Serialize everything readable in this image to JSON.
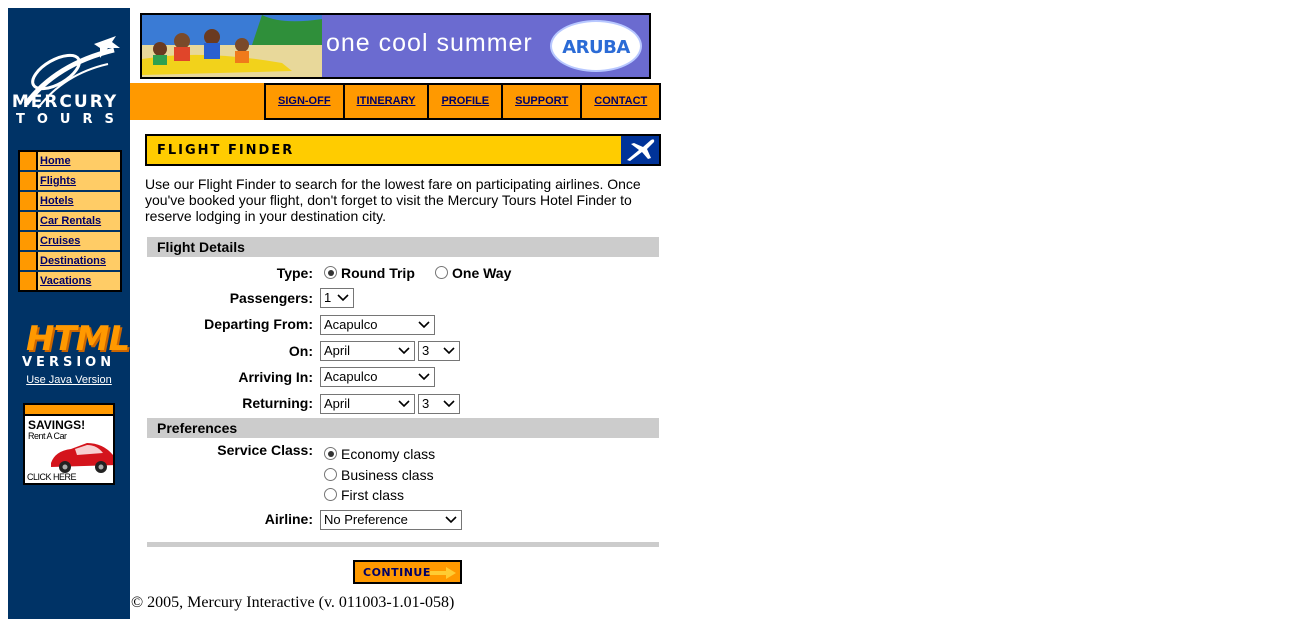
{
  "sidebar": {
    "logo_line1": "MERCURY",
    "logo_line2": "TOURS",
    "nav_items": [
      {
        "label": "Home"
      },
      {
        "label": "Flights"
      },
      {
        "label": "Hotels"
      },
      {
        "label": "Car Rentals"
      },
      {
        "label": "Cruises"
      },
      {
        "label": "Destinations"
      },
      {
        "label": "Vacations"
      }
    ],
    "badge_line1": "HTML",
    "badge_line2": "VERSION",
    "java_link": "Use Java Version",
    "ad": {
      "title": "SAVINGS!",
      "subtitle": "Rent A Car",
      "cta": "CLICK HERE"
    }
  },
  "banner": {
    "text": "one cool summer",
    "brand": "ARUBA"
  },
  "topnav": {
    "items": [
      "SIGN-OFF",
      "ITINERARY",
      "PROFILE",
      "SUPPORT",
      "CONTACT"
    ]
  },
  "flight_finder": {
    "title": "FLIGHT FINDER",
    "intro": "Use our Flight Finder to search for the lowest fare on participating airlines. Once you've booked your flight, don't forget to visit the Mercury Tours Hotel Finder to reserve lodging in your destination city."
  },
  "flight_details": {
    "section_title": "Flight Details",
    "type_label": "Type:",
    "type_options": [
      "Round Trip",
      "One Way"
    ],
    "type_selected": "Round Trip",
    "passengers_label": "Passengers:",
    "passengers_value": "1",
    "departing_label": "Departing From:",
    "departing_value": "Acapulco",
    "on_label": "On:",
    "on_month": "April",
    "on_day": "3",
    "arriving_label": "Arriving In:",
    "arriving_value": "Acapulco",
    "returning_label": "Returning:",
    "returning_month": "April",
    "returning_day": "3"
  },
  "preferences": {
    "section_title": "Preferences",
    "service_label": "Service Class:",
    "service_options": [
      "Economy class",
      "Business class",
      "First class"
    ],
    "service_selected": "Economy class",
    "airline_label": "Airline:",
    "airline_value": "No Preference"
  },
  "continue_label": "CONTINUE",
  "footer": "© 2005, Mercury Interactive (v. 011003-1.01-058)",
  "colors": {
    "sidebar": "#003366",
    "accent_orange": "#ff9900",
    "header_yellow": "#ffcc00",
    "nav_link": "#000066",
    "section_grey": "#cccccc"
  }
}
